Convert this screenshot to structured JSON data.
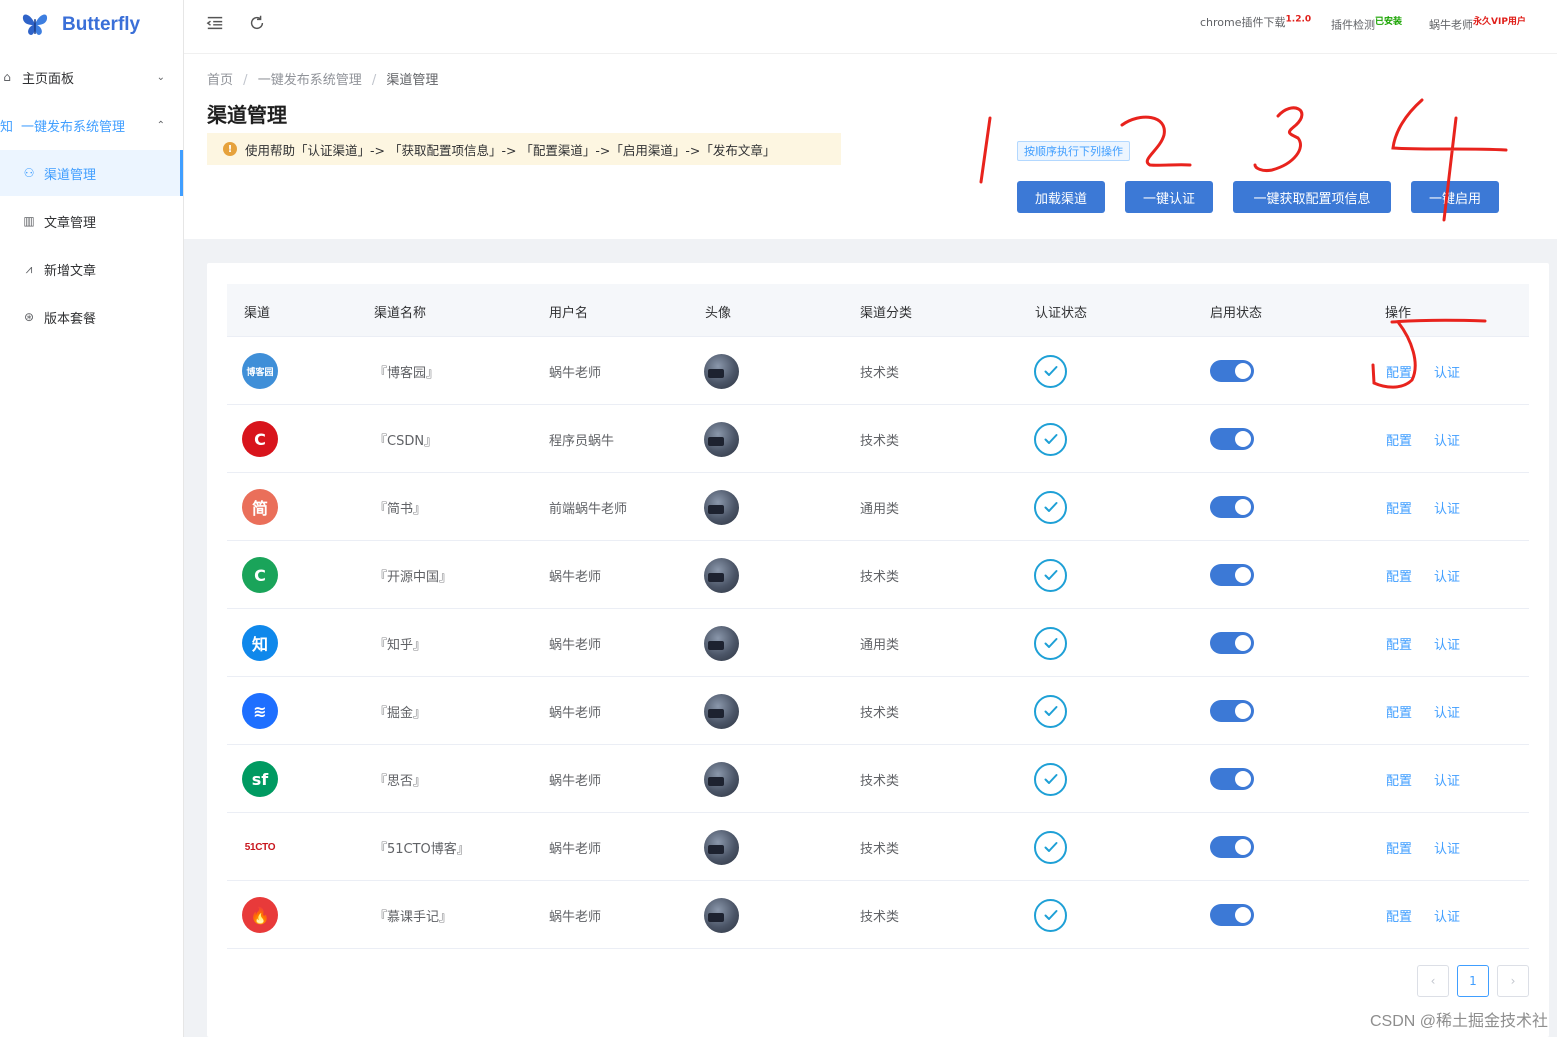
{
  "app": {
    "name": "Butterfly"
  },
  "sidebar": {
    "items": [
      {
        "label": "主页面板",
        "icon": "home-icon"
      },
      {
        "label": "一键发布系统管理",
        "prefix": "知"
      },
      {
        "label": "渠道管理",
        "icon": "channel-icon"
      },
      {
        "label": "文章管理",
        "icon": "book-icon"
      },
      {
        "label": "新增文章",
        "icon": "line-chart-icon"
      },
      {
        "label": "版本套餐",
        "icon": "version-icon"
      }
    ]
  },
  "header": {
    "chrome_plugin": "chrome插件下载",
    "chrome_version": "1.2.0",
    "plugin_check": "插件检测",
    "plugin_installed": "已安装",
    "user_name": "蜗牛老师",
    "user_level": "永久VIP用户",
    "colors": {
      "version": "#e0201b",
      "installed": "#19a300",
      "vip": "#e0201b"
    }
  },
  "breadcrumb": {
    "home": "首页",
    "parent": "一键发布系统管理",
    "current": "渠道管理",
    "separator": "/"
  },
  "page": {
    "title": "渠道管理",
    "help_text": "使用帮助「认证渠道」-> 「获取配置项信息」-> 「配置渠道」->「启用渠道」->「发布文章」",
    "order_tag": "按顺序执行下列操作"
  },
  "actions": {
    "load": "加载渠道",
    "auth_all": "一键认证",
    "fetch_config": "一键获取配置项信息",
    "enable_all": "一键启用"
  },
  "table": {
    "columns": [
      "渠道",
      "渠道名称",
      "用户名",
      "头像",
      "渠道分类",
      "认证状态",
      "启用状态",
      "操作"
    ],
    "rows": [
      {
        "name": "『博客园』",
        "user": "蜗牛老师",
        "category": "技术类",
        "logo_text": "博客园",
        "logo_color": "#3f8fd8"
      },
      {
        "name": "『CSDN』",
        "user": "程序员蜗牛",
        "category": "技术类",
        "logo_text": "C",
        "logo_color": "#d8141c"
      },
      {
        "name": "『简书』",
        "user": "前端蜗牛老师",
        "category": "通用类",
        "logo_text": "简",
        "logo_color": "#ea6f5a"
      },
      {
        "name": "『开源中国』",
        "user": "蜗牛老师",
        "category": "技术类",
        "logo_text": "C",
        "logo_color": "#1aa45a"
      },
      {
        "name": "『知乎』",
        "user": "蜗牛老师",
        "category": "通用类",
        "logo_text": "知",
        "logo_color": "#0f88eb"
      },
      {
        "name": "『掘金』",
        "user": "蜗牛老师",
        "category": "技术类",
        "logo_text": "≋",
        "logo_color": "#1e6fff"
      },
      {
        "name": "『思否』",
        "user": "蜗牛老师",
        "category": "技术类",
        "logo_text": "sf",
        "logo_color": "#009a61"
      },
      {
        "name": "『51CTO博客』",
        "user": "蜗牛老师",
        "category": "技术类",
        "logo_text": "51CTO",
        "logo_color": "#ffffff"
      },
      {
        "name": "『慕课手记』",
        "user": "蜗牛老师",
        "category": "技术类",
        "logo_text": "🔥",
        "logo_color": "#e83a3a"
      }
    ],
    "action_config": "配置",
    "action_auth": "认证",
    "auth_verified": true,
    "enabled": true
  },
  "pagination": {
    "current": "1",
    "prev": "‹",
    "next": "›"
  },
  "watermark": "CSDN @稀土掘金技术社区",
  "annotations": [
    "1",
    "2",
    "3",
    "4",
    "5"
  ]
}
